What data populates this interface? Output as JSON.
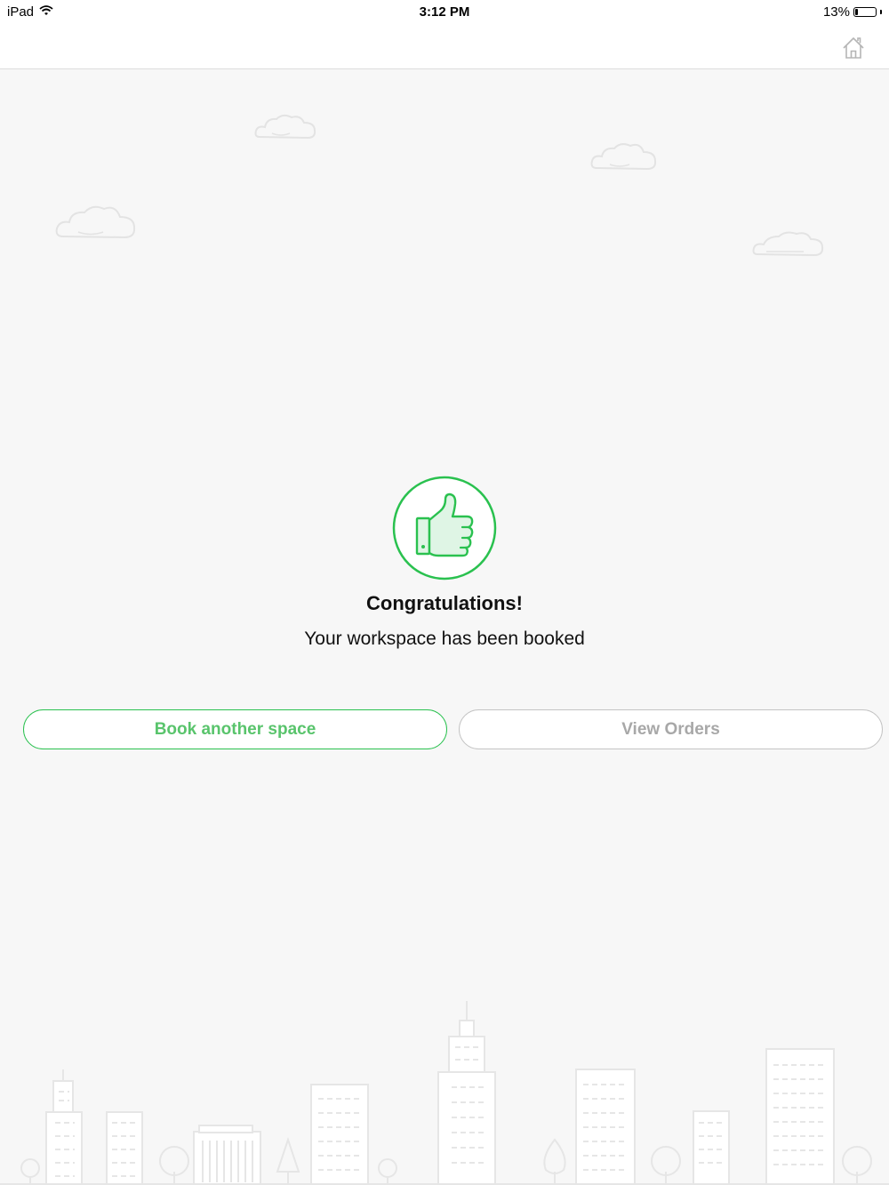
{
  "status_bar": {
    "device": "iPad",
    "time": "3:12 PM",
    "battery_percent": "13%",
    "battery_level": 0.13
  },
  "nav": {
    "home_icon": "home-icon"
  },
  "confirmation": {
    "icon": "thumbs-up-icon",
    "title": "Congratulations!",
    "message": "Your workspace has been booked"
  },
  "actions": {
    "book_another": "Book another space",
    "view_orders": "View Orders"
  },
  "colors": {
    "accent": "#2ac14f",
    "accent_text": "#59c46c",
    "disabled_text": "#a8a8a8",
    "background": "#f7f7f7"
  }
}
